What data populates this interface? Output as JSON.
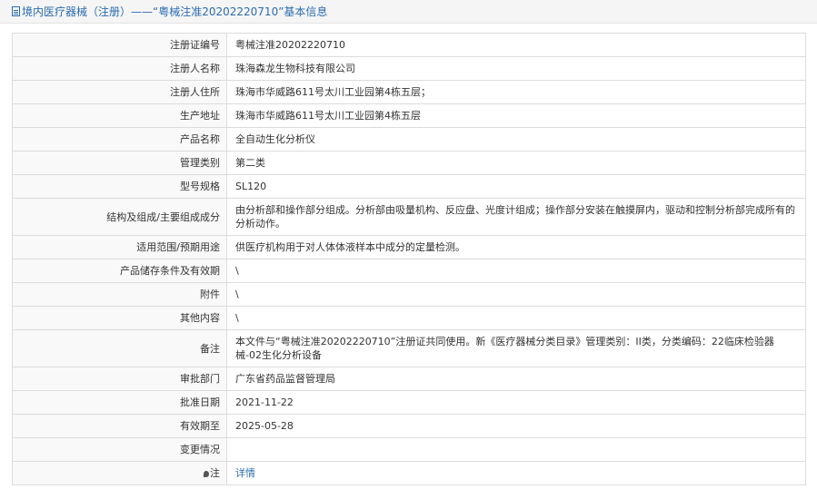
{
  "header": {
    "title": "境内医疗器械（注册）——“粤械注准20202220710”基本信息",
    "icon": "document-icon"
  },
  "rows": [
    {
      "label": "注册证编号",
      "value": "粤械注准20202220710"
    },
    {
      "label": "注册人名称",
      "value": "珠海森龙生物科技有限公司"
    },
    {
      "label": "注册人住所",
      "value": "珠海市华威路611号太川工业园第4栋五层；"
    },
    {
      "label": "生产地址",
      "value": "珠海市华威路611号太川工业园第4栋五层"
    },
    {
      "label": "产品名称",
      "value": "全自动生化分析仪"
    },
    {
      "label": "管理类别",
      "value": "第二类"
    },
    {
      "label": "型号规格",
      "value": "SL120"
    },
    {
      "label": "结构及组成/主要组成成分",
      "value": "由分析部和操作部分组成。分析部由吸量机构、反应盘、光度计组成；操作部分安装在触摸屏内，驱动和控制分析部完成所有的分析动作。"
    },
    {
      "label": "适用范围/预期用途",
      "value": "供医疗机构用于对人体体液样本中成分的定量检测。"
    },
    {
      "label": "产品储存条件及有效期",
      "value": "\\"
    },
    {
      "label": "附件",
      "value": "\\"
    },
    {
      "label": "其他内容",
      "value": "\\"
    },
    {
      "label": "备注",
      "value": "本文件与“粤械注准20202220710”注册证共同使用。新《医疗器械分类目录》管理类别：II类，分类编码：22临床检验器械-02生化分析设备"
    },
    {
      "label": "审批部门",
      "value": "广东省药品监督管理局"
    },
    {
      "label": "批准日期",
      "value": "2021-11-22"
    },
    {
      "label": "有效期至",
      "value": "2025-05-28"
    },
    {
      "label": "变更情况",
      "value": ""
    },
    {
      "label": "注",
      "value": "详情",
      "label_icon": "pin-icon"
    }
  ],
  "colors": {
    "accent": "#2b6cb0",
    "header_bg": "#f5f5f5",
    "label_bg": "#f9f9f9",
    "border": "#dcdcdc"
  }
}
